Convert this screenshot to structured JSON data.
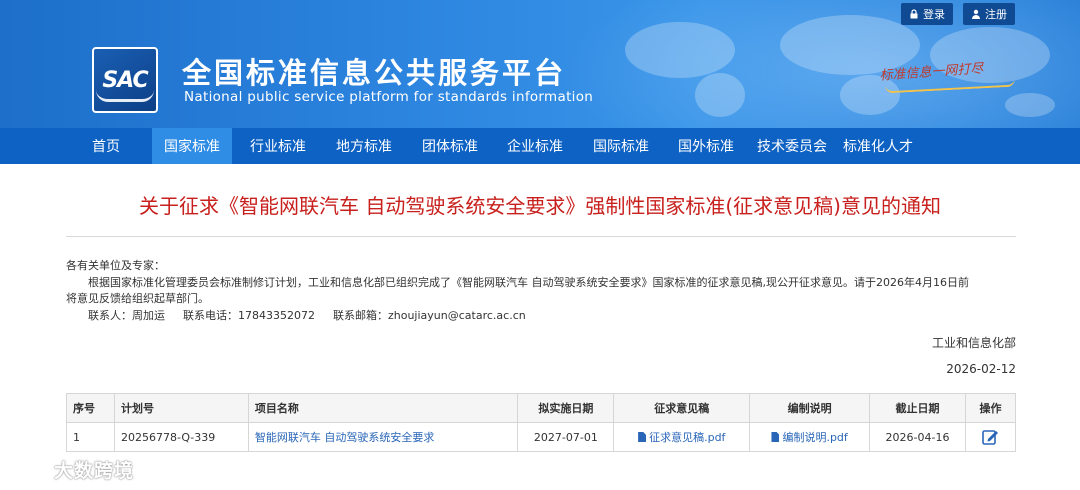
{
  "header": {
    "logo_text": "SAC",
    "title_cn": "全国标准信息公共服务平台",
    "title_en": "National public service platform  for standards information",
    "slogan": "标准信息一网打尽",
    "login_label": "登录",
    "register_label": "注册"
  },
  "nav": {
    "items": [
      {
        "label": "首页"
      },
      {
        "label": "国家标准"
      },
      {
        "label": "行业标准"
      },
      {
        "label": "地方标准"
      },
      {
        "label": "团体标准"
      },
      {
        "label": "企业标准"
      },
      {
        "label": "国际标准"
      },
      {
        "label": "国外标准"
      },
      {
        "label": "技术委员会"
      },
      {
        "label": "标准化人才"
      }
    ],
    "active_index": 1
  },
  "notice": {
    "title": "关于征求《智能网联汽车 自动驾驶系统安全要求》强制性国家标准(征求意见稿)意见的通知",
    "salutation": "各有关单位及专家：",
    "paragraph_line1": "根据国家标准化管理委员会标准制修订计划，工业和信息化部已组织完成了《智能网联汽车 自动驾驶系统安全要求》国家标准的征求意见稿,现公开征求意见。请于2026年4月16日前",
    "paragraph_line2": "将意见反馈给组织起草部门。",
    "contact_person": "联系人：周加运",
    "contact_phone": "联系电话：17843352072",
    "contact_email": "联系邮箱：zhoujiayun@catarc.ac.cn",
    "issuer": "工业和信息化部",
    "date": "2026-02-12"
  },
  "table": {
    "headers": [
      "序号",
      "计划号",
      "项目名称",
      "拟实施日期",
      "征求意见稿",
      "编制说明",
      "截止日期",
      "操作"
    ],
    "rows": [
      {
        "index": "1",
        "plan_no": "20256778-Q-339",
        "name": "智能网联汽车 自动驾驶系统安全要求",
        "implement_date": "2027-07-01",
        "draft_file": "征求意见稿.pdf",
        "explain_file": "编制说明.pdf",
        "deadline": "2026-04-16"
      }
    ]
  },
  "watermark": {
    "text": "大数跨境"
  },
  "colors": {
    "nav_bg": "#0d62c4",
    "nav_active": "#2f8de6",
    "title_red": "#c8201d",
    "link_blue": "#2a66b8"
  }
}
